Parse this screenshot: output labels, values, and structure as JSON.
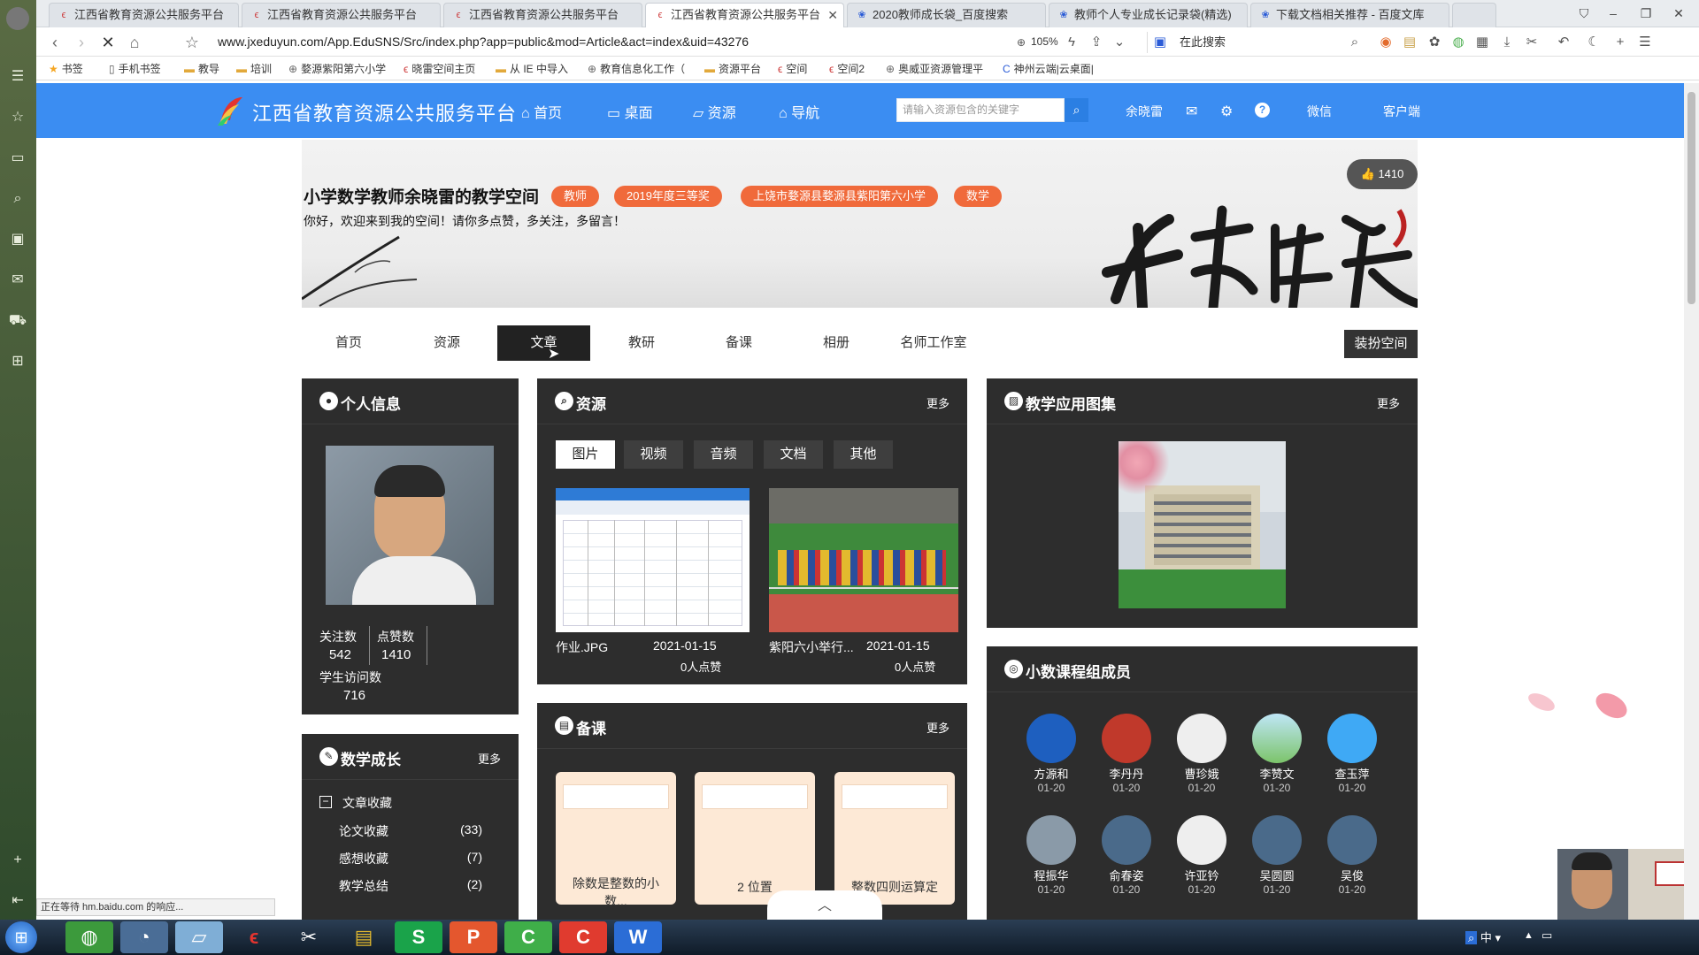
{
  "browser": {
    "tabs": [
      {
        "title": "江西省教育资源公共服务平台",
        "active": false
      },
      {
        "title": "江西省教育资源公共服务平台",
        "active": false
      },
      {
        "title": "江西省教育资源公共服务平台",
        "active": false
      },
      {
        "title": "江西省教育资源公共服务平台",
        "active": true
      },
      {
        "title": "2020教师成长袋_百度搜索",
        "active": false
      },
      {
        "title": "教师个人专业成长记录袋(精选)",
        "active": false
      },
      {
        "title": "下载文档相关推荐 - 百度文库",
        "active": false
      }
    ],
    "url": "www.jxeduyun.com/App.EduSNS/Src/index.php?app=public&mod=Article&act=index&uid=43276",
    "zoom": "105%",
    "search_placeholder": "在此搜索",
    "bookmarks": [
      "书签",
      "手机书签",
      "教导",
      "培训",
      "婺源紫阳第六小学",
      "晓雷空间主页",
      "从 IE 中导入",
      "教育信息化工作（",
      "资源平台",
      "空间",
      "空间2",
      "奥威亚资源管理平",
      "神州云端|云桌面|"
    ],
    "status_text": "正在等待 hm.baidu.com 的响应..."
  },
  "site": {
    "title": "江西省教育资源公共服务平台",
    "nav": [
      "首页",
      "桌面",
      "资源",
      "导航"
    ],
    "search_placeholder": "请输入资源包含的关键字",
    "user": "余晓雷",
    "links": [
      "微信",
      "客户端"
    ]
  },
  "banner": {
    "title": "小学数学教师余晓雷的教学空间",
    "tags": [
      "教师",
      "2019年度三等奖",
      "上饶市婺源县婺源县紫阳第六小学",
      "数学"
    ],
    "welcome": "你好，欢迎来到我的空间！请你多点赞，多关注，多留言！",
    "likes": "1410"
  },
  "space_nav": {
    "tabs": [
      "首页",
      "资源",
      "文章",
      "教研",
      "备课",
      "相册",
      "名师工作室"
    ],
    "active": "文章",
    "dress_button": "装扮空间"
  },
  "profile": {
    "title": "个人信息",
    "stats": [
      {
        "label": "关注数",
        "value": "542"
      },
      {
        "label": "点赞数",
        "value": "1410"
      },
      {
        "label": "学生访问数",
        "value": "716"
      }
    ]
  },
  "growth": {
    "title": "数学成长",
    "more": "更多",
    "folder": "文章收藏",
    "items": [
      {
        "label": "论文收藏",
        "count": "(33)"
      },
      {
        "label": "感想收藏",
        "count": "(7)"
      },
      {
        "label": "教学总结",
        "count": "(2)"
      }
    ]
  },
  "resources": {
    "title": "资源",
    "more": "更多",
    "filters": [
      "图片",
      "视频",
      "音频",
      "文档",
      "其他"
    ],
    "active_filter": "图片",
    "items": [
      {
        "name": "作业.JPG",
        "date": "2021-01-15",
        "likes": "0人点赞"
      },
      {
        "name": "紫阳六小举行...",
        "date": "2021-01-15",
        "likes": "0人点赞"
      }
    ]
  },
  "prep": {
    "title": "备课",
    "more": "更多",
    "cards": [
      "除数是整数的小数...",
      "2 位置",
      "整数四则运算定"
    ]
  },
  "gallery": {
    "title": "教学应用图集",
    "more": "更多"
  },
  "members": {
    "title": "小数课程组成员",
    "list": [
      {
        "name": "方源和",
        "date": "01-20"
      },
      {
        "name": "李丹丹",
        "date": "01-20"
      },
      {
        "name": "曹珍娥",
        "date": "01-20"
      },
      {
        "name": "李赞文",
        "date": "01-20"
      },
      {
        "name": "查玉萍",
        "date": "01-20"
      },
      {
        "name": "程振华",
        "date": "01-20"
      },
      {
        "name": "俞春姿",
        "date": "01-20"
      },
      {
        "name": "许亚钤",
        "date": "01-20"
      },
      {
        "name": "吴圆圆",
        "date": "01-20"
      },
      {
        "name": "吴俊",
        "date": "01-20"
      }
    ]
  },
  "taskbar": {
    "ime": "中"
  }
}
